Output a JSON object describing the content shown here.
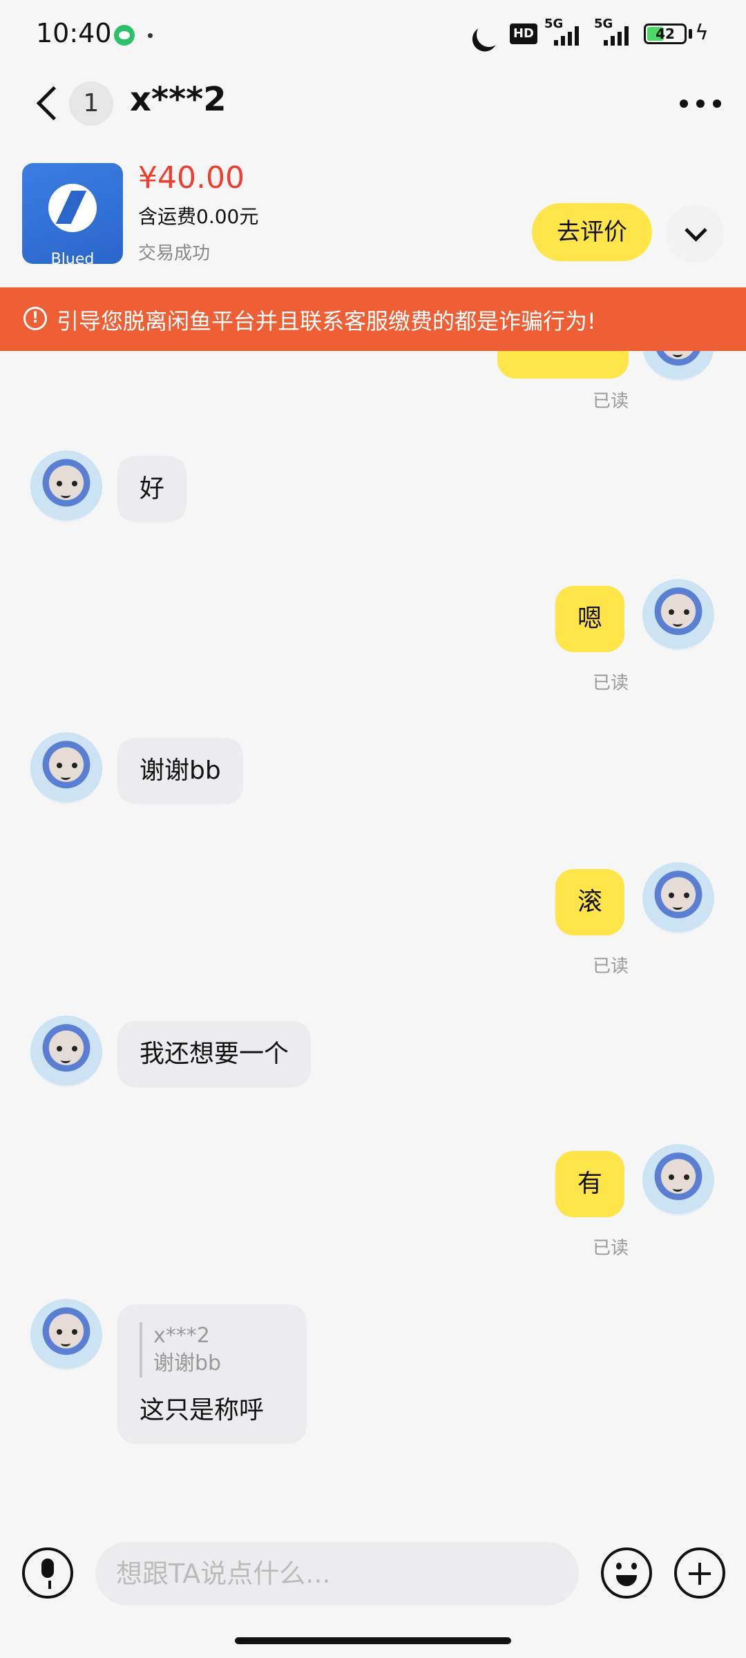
{
  "status_bar": {
    "time": "10:40",
    "network_left": "5G",
    "network_right": "5G",
    "battery": "42",
    "icons": [
      "wechat-icon",
      "moon-icon",
      "hd-icon",
      "signal-icon",
      "battery-icon",
      "charging-icon"
    ],
    "hd_label": "HD"
  },
  "nav": {
    "unread_count": "1",
    "title": "x***2",
    "icons": [
      "back-icon",
      "more-icon"
    ]
  },
  "product": {
    "price": "¥40.00",
    "shipping": "含运费0.00元",
    "status": "交易成功",
    "thumb_brand": "Blued",
    "review_button": "去评价"
  },
  "warning": {
    "text": "引导您脱离闲鱼平台并且联系客服缴费的都是诈骗行为!"
  },
  "messages": [
    {
      "side": "in",
      "text": "好"
    },
    {
      "side": "out",
      "text": "嗯",
      "status": "已读"
    },
    {
      "side": "in",
      "text": "谢谢bb"
    },
    {
      "side": "out",
      "text": "滚",
      "status": "已读"
    },
    {
      "side": "in",
      "text": "我还想要一个"
    },
    {
      "side": "out",
      "text": "有",
      "status": "已读"
    },
    {
      "side": "in",
      "text": "这只是称呼",
      "quote": {
        "name": "x***2",
        "text": "谢谢bb"
      }
    }
  ],
  "top_partial_read": "已读",
  "input": {
    "placeholder": "想跟TA说点什么..."
  },
  "colors": {
    "accent_yellow": "#ffe54a",
    "price_red": "#ef3d2f",
    "warning_orange": "#ef5f35"
  }
}
